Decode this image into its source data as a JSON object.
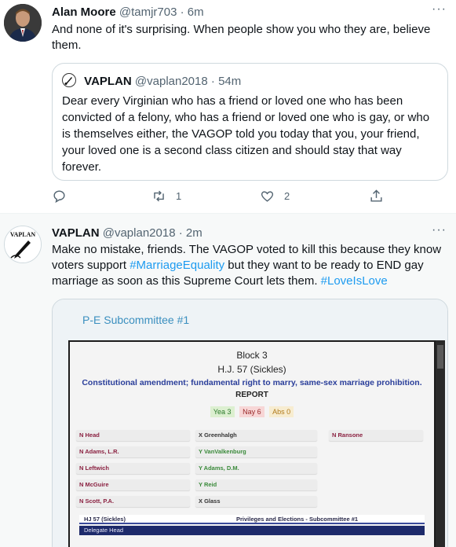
{
  "tweet1": {
    "name": "Alan Moore",
    "handle": "@tamjr703",
    "time": "6m",
    "text": "And none of it's surprising.  When people show you who they are, believe them.",
    "quote": {
      "name": "VAPLAN",
      "handle": "@vaplan2018",
      "time": "54m",
      "text": "Dear every Virginian who has a friend or loved one who has been convicted of a felony, who has a friend or loved one who is gay, or who is themselves either, the VAGOP told you today that you, your friend, your loved one is a second class citizen and should stay that way forever."
    },
    "actions": {
      "reply_count": "",
      "retweet_count": "1",
      "like_count": "2"
    }
  },
  "tweet2": {
    "name": "VAPLAN",
    "handle": "@vaplan2018",
    "time": "2m",
    "avatar_text": "VAPLAN",
    "text_before": "Make no mistake, friends. The VAGOP voted to kill this because they know voters support ",
    "hashtag1": "#MarriageEquality",
    "text_middle": " but they want to be ready to END gay marriage as soon as this Supreme Court lets them. ",
    "hashtag2": "#LoveIsLove",
    "image": {
      "subcommittee_title": "P-E Subcommittee #1",
      "block": "Block 3",
      "bill": "H.J. 57 (Sickles)",
      "description": "Constitutional amendment; fundamental right to marry, same-sex marriage prohibition.",
      "report": "REPORT",
      "yea": "Yea 3",
      "nay": "Nay 6",
      "abs": "Abs 0",
      "votes": [
        {
          "vote": "N",
          "member": "Head"
        },
        {
          "vote": "X",
          "member": "Greenhalgh"
        },
        {
          "vote": "N",
          "member": "Ransone"
        },
        {
          "vote": "N",
          "member": "Adams, L.R."
        },
        {
          "vote": "Y",
          "member": "VanValkenburg"
        },
        {
          "vote": "N",
          "member": "Leftwich"
        },
        {
          "vote": "Y",
          "member": "Adams, D.M."
        },
        {
          "vote": "N",
          "member": "McGuire"
        },
        {
          "vote": "Y",
          "member": "Reid"
        },
        {
          "vote": "N",
          "member": "Scott, P.A."
        },
        {
          "vote": "X",
          "member": "Glass"
        }
      ],
      "footer_bill": "HJ 57   (Sickles)",
      "footer_committee": "Privileges and Elections - Subcommittee #1",
      "footer_delegate": "Delegate Head"
    }
  },
  "colors": {
    "accent": "#1d9bf0",
    "muted": "#536471",
    "vote_n": "#8a2040",
    "vote_y": "#3a8a3a"
  }
}
